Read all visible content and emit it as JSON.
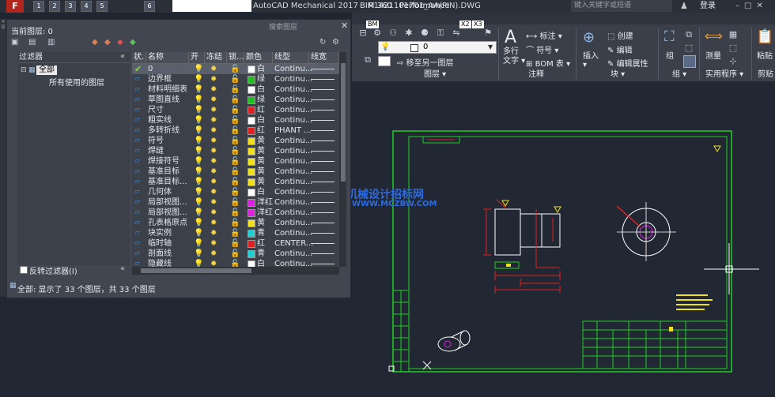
{
  "titlebar": {
    "app_letter": "F",
    "quick_access": [
      "1",
      "2",
      "3",
      "4",
      "5",
      "6"
    ],
    "title": "AutoCAD Mechanical 2017",
    "file": "R1421101701_AA(PIN).DWG",
    "search_placeholder": "键入关键字或短语",
    "login": "登录"
  },
  "ribbon": {
    "tabs": [
      "BIM 360",
      "Performance"
    ],
    "tooltips": [
      "BM",
      "X2",
      "X3"
    ],
    "layer_combo": "0",
    "move_to_layer": "移至另一图层",
    "multiline_text": [
      "多行",
      "文字"
    ],
    "annotation": [
      "标注",
      "符号",
      "BOM 表"
    ],
    "block": {
      "insert": "插入",
      "create": "创建",
      "edit": "编辑",
      "edit_attr": "编辑属性"
    },
    "group": "组",
    "measure": "测量",
    "paste": "粘贴",
    "panel_labels": [
      "图层",
      "注释",
      "块",
      "组",
      "实用程序",
      "剪贴"
    ]
  },
  "layer_manager": {
    "current_layer": "当前图层: 0",
    "search_placeholder": "搜索图层",
    "filters_header": "过滤器",
    "tree_all": "全部",
    "tree_used": "所有使用的图层",
    "invert_filter": "反转过滤器(I)",
    "columns": [
      "状.",
      "名称",
      "开",
      "冻结",
      "锁...",
      "颜色",
      "线型",
      "线宽"
    ],
    "rows": [
      {
        "name": "0",
        "color": "白",
        "hex": "#ffffff",
        "linetype": "Continu...",
        "current": true
      },
      {
        "name": "边界框",
        "color": "绿",
        "hex": "#20c020",
        "linetype": "Continu..."
      },
      {
        "name": "材料明细表",
        "color": "白",
        "hex": "#ffffff",
        "linetype": "Continu..."
      },
      {
        "name": "草图直线",
        "color": "绿",
        "hex": "#20c020",
        "linetype": "Continu..."
      },
      {
        "name": "尺寸",
        "color": "红",
        "hex": "#e02020",
        "linetype": "Continu..."
      },
      {
        "name": "粗实线",
        "color": "白",
        "hex": "#ffffff",
        "linetype": "Continu..."
      },
      {
        "name": "多转折线",
        "color": "红",
        "hex": "#e02020",
        "linetype": "PHANT ..."
      },
      {
        "name": "符号",
        "color": "黄",
        "hex": "#f0e020",
        "linetype": "Continu..."
      },
      {
        "name": "焊缝",
        "color": "黄",
        "hex": "#f0e020",
        "linetype": "Continu..."
      },
      {
        "name": "焊接符号",
        "color": "黄",
        "hex": "#f0e020",
        "linetype": "Continu..."
      },
      {
        "name": "基准目标",
        "color": "黄",
        "hex": "#f0e020",
        "linetype": "Continu..."
      },
      {
        "name": "基准目标...",
        "color": "黄",
        "hex": "#f0e020",
        "linetype": "Continu..."
      },
      {
        "name": "几何体",
        "color": "白",
        "hex": "#ffffff",
        "linetype": "Continu..."
      },
      {
        "name": "局部视图...",
        "color": "洋红",
        "hex": "#e020e0",
        "linetype": "Continu..."
      },
      {
        "name": "局部视图...",
        "color": "洋红",
        "hex": "#e020e0",
        "linetype": "Continu..."
      },
      {
        "name": "孔表格原点",
        "color": "黄",
        "hex": "#f0e020",
        "linetype": "Continu..."
      },
      {
        "name": "块实例",
        "color": "青",
        "hex": "#20d0d0",
        "linetype": "Continu..."
      },
      {
        "name": "临时轴",
        "color": "红",
        "hex": "#e02020",
        "linetype": "CENTER..."
      },
      {
        "name": "剖面线",
        "color": "青",
        "hex": "#20d0d0",
        "linetype": "Continu..."
      },
      {
        "name": "隐藏线",
        "color": "白",
        "hex": "#ffffff",
        "linetype": "Continu..."
      }
    ],
    "status": "全部: 显示了 33 个图层，共 33 个图层"
  },
  "drawing": {
    "watermark_cn": "机械设计招标网",
    "watermark_url": "WWW.MCZBW.COM"
  },
  "colors": {
    "border": "#20d020",
    "dim": "#e02020",
    "geometry": "#ffffff",
    "watermark": "#2d6ae0"
  }
}
